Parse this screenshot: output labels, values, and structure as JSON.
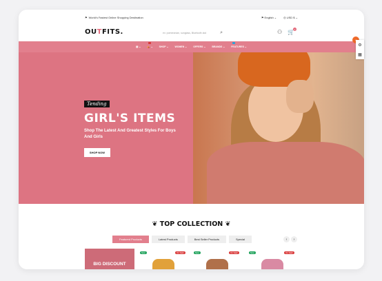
{
  "topbar": {
    "tagline": "World's Fastest Online Shopping Destination",
    "language": "English",
    "currency": "USD $"
  },
  "header": {
    "logo_left": "OU",
    "logo_accent": "T",
    "logo_right": "FITS.",
    "search_placeholder": "ex: pomeranian, sunglass, Bluetooth dcd",
    "cart_count": "1"
  },
  "nav": {
    "items": [
      {
        "label": "SHOP",
        "tag": ""
      },
      {
        "label": "WOMEN",
        "tag": ""
      },
      {
        "label": "OFFERS",
        "tag": ""
      },
      {
        "label": "BRANDS",
        "tag": ""
      },
      {
        "label": "FEATURES",
        "tag": ""
      }
    ]
  },
  "hero": {
    "badge": "Tending",
    "title": "GIRL'S ITEMS",
    "subtitle": "Shop The Latest And Greatest Styles For Boys And Girls",
    "cta": "SHOP NOW"
  },
  "collection": {
    "heading": "TOP COLLECTION",
    "tabs": [
      "Featured Products",
      "Latest Products",
      "Best Seller Products",
      "Special"
    ],
    "promo": "BIG DISCOUNT",
    "badge_new": "New",
    "badge_sale": "On Sale!"
  },
  "colors": {
    "brand_pink": "#e27f8d",
    "hero_bg": "#dd7482",
    "sale_red": "#d93a3a",
    "new_green": "#1fa25b"
  }
}
